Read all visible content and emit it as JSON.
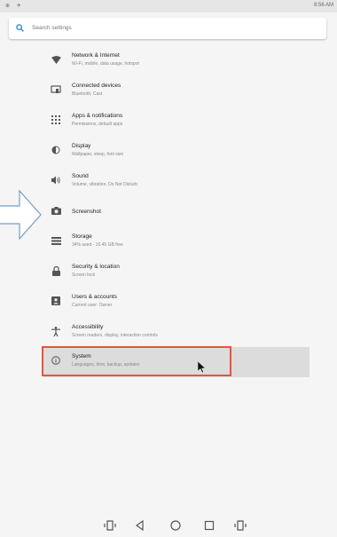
{
  "status_bar": {
    "left_icons": "⊕ ✈",
    "time": "8:56 AM"
  },
  "search": {
    "placeholder": "Search settings"
  },
  "items": [
    {
      "title": "Network & Internet",
      "subtitle": "Wi-Fi, mobile, data usage, hotspot",
      "icon": "wifi-icon"
    },
    {
      "title": "Connected devices",
      "subtitle": "Bluetooth, Cast",
      "icon": "connected-devices-icon"
    },
    {
      "title": "Apps & notifications",
      "subtitle": "Permissions, default apps",
      "icon": "apps-grid-icon"
    },
    {
      "title": "Display",
      "subtitle": "Wallpaper, sleep, font size",
      "icon": "brightness-icon"
    },
    {
      "title": "Sound",
      "subtitle": "Volume, vibration, Do Not Disturb",
      "icon": "volume-icon"
    },
    {
      "title": "Screenshot",
      "subtitle": "",
      "icon": "camera-icon"
    },
    {
      "title": "Storage",
      "subtitle": "34% used - 10.45 GB free",
      "icon": "storage-icon"
    },
    {
      "title": "Security & location",
      "subtitle": "Screen lock",
      "icon": "lock-icon"
    },
    {
      "title": "Users & accounts",
      "subtitle": "Current user: Owner",
      "icon": "account-icon"
    },
    {
      "title": "Accessibility",
      "subtitle": "Screen readers, display, interaction controls",
      "icon": "accessibility-icon"
    },
    {
      "title": "System",
      "subtitle": "Languages, time, backup, updates",
      "icon": "info-icon"
    }
  ],
  "nav": [
    "screenshot-left-icon",
    "back-icon",
    "home-icon",
    "recents-icon",
    "screenshot-right-icon"
  ],
  "colors": {
    "highlight": "#e8533f",
    "arrow": "#7a9cc6",
    "selected_bg": "#dcdcdc"
  }
}
